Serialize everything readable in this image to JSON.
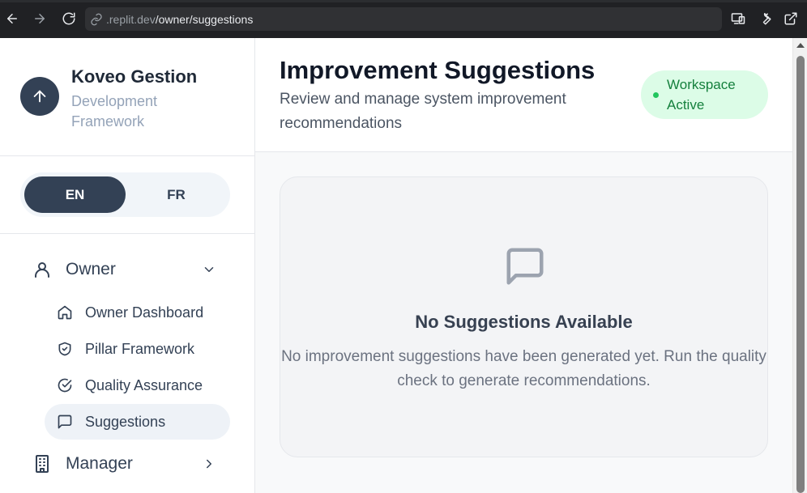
{
  "browser": {
    "url_domain": ".replit.dev",
    "url_path": "/owner/suggestions",
    "icons": [
      "back-icon",
      "forward-icon",
      "reload-icon",
      "link-icon",
      "devices-icon",
      "wrench-icon",
      "open-external-icon"
    ]
  },
  "sidebar": {
    "brand_title": "Koveo Gestion",
    "brand_subtitle": "Development Framework",
    "lang": {
      "en": "EN",
      "fr": "FR",
      "selected": "EN"
    },
    "groups": [
      {
        "label": "Owner",
        "icon": "user-icon",
        "expanded": true,
        "items": [
          {
            "label": "Owner Dashboard",
            "icon": "home-icon"
          },
          {
            "label": "Pillar Framework",
            "icon": "shield-check-icon"
          },
          {
            "label": "Quality Assurance",
            "icon": "check-circle-icon"
          },
          {
            "label": "Suggestions",
            "icon": "message-square-icon",
            "active": true
          }
        ]
      },
      {
        "label": "Manager",
        "icon": "building-icon",
        "expanded": false
      }
    ]
  },
  "main": {
    "title": "Improvement Suggestions",
    "subtitle": "Review and manage system improvement recommendations",
    "status": "Workspace Active",
    "empty": {
      "icon": "message-square-icon",
      "title": "No Suggestions Available",
      "description": "No improvement suggestions have been generated yet. Run the quality check to generate recommendations."
    }
  },
  "colors": {
    "browser_bg": "#202124",
    "brand_avatar": "#334155",
    "status_bg": "#dcfce7",
    "status_text": "#15803d",
    "status_dot": "#22c55e",
    "active_item_bg": "#eef2f7"
  }
}
